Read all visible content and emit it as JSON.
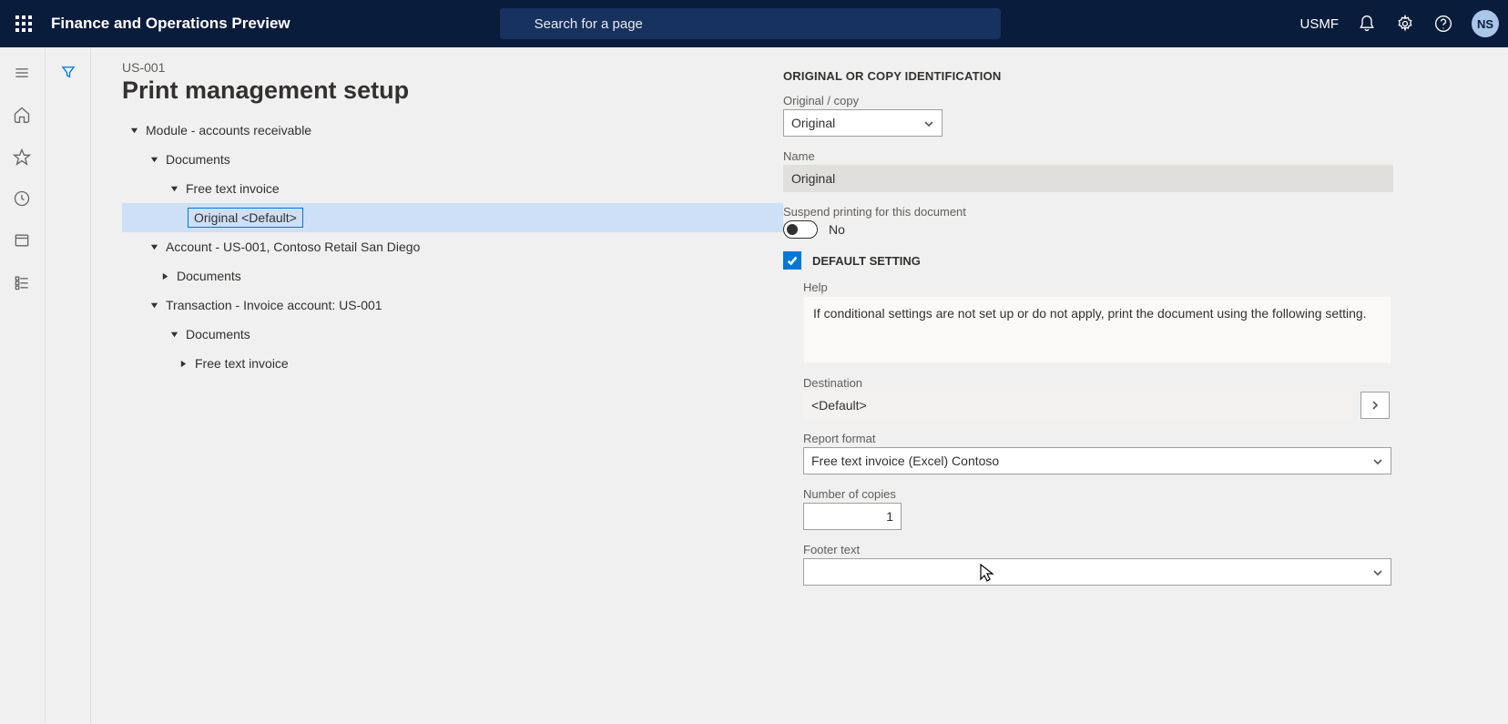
{
  "header": {
    "app_title": "Finance and Operations Preview",
    "search_placeholder": "Search for a page",
    "company": "USMF",
    "avatar_initials": "NS"
  },
  "page": {
    "breadcrumb": "US-001",
    "title": "Print management setup"
  },
  "tree": {
    "n0": "Module - accounts receivable",
    "n1": "Documents",
    "n2": "Free text invoice",
    "n3": "Original <Default>",
    "n4": "Account - US-001, Contoso Retail San Diego",
    "n5": "Documents",
    "n6": "Transaction - Invoice account: US-001",
    "n7": "Documents",
    "n8": "Free text invoice"
  },
  "form": {
    "section1_label": "ORIGINAL OR COPY IDENTIFICATION",
    "original_copy_label": "Original / copy",
    "original_copy_value": "Original",
    "name_label": "Name",
    "name_value": "Original",
    "suspend_label": "Suspend printing for this document",
    "suspend_value": "No",
    "default_setting_label": "DEFAULT SETTING",
    "help_label": "Help",
    "help_text": "If conditional settings are not set up or do not apply, print the document using the following setting.",
    "destination_label": "Destination",
    "destination_value": "<Default>",
    "report_format_label": "Report format",
    "report_format_value": "Free text invoice (Excel) Contoso",
    "copies_label": "Number of copies",
    "copies_value": "1",
    "footer_label": "Footer text",
    "footer_value": ""
  }
}
